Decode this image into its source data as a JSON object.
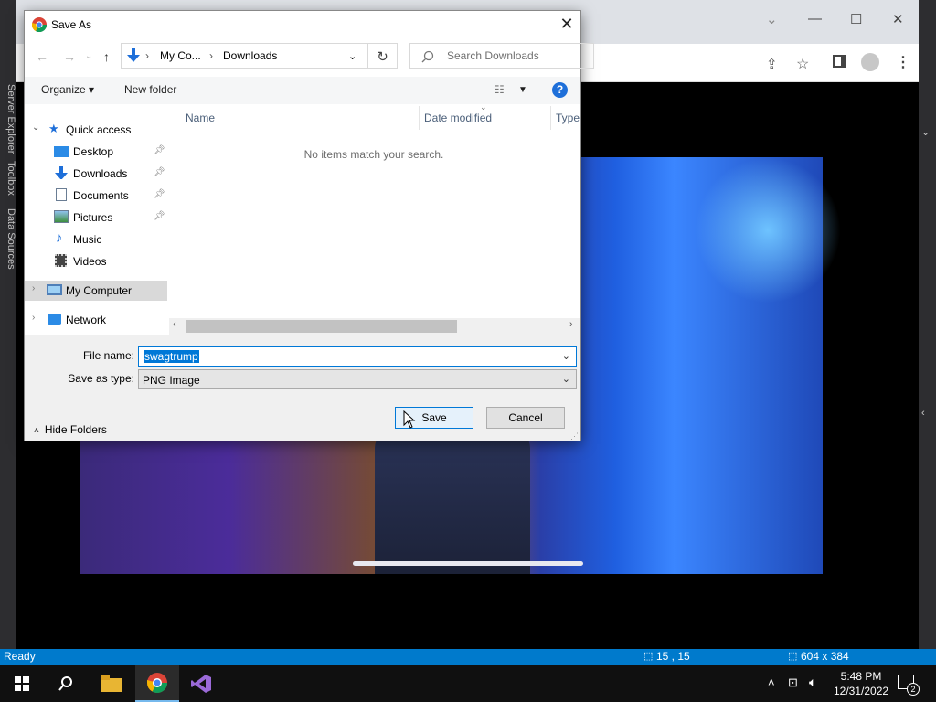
{
  "vs": {
    "left_tabs": [
      "Server Explorer",
      "Toolbox",
      "Data Sources"
    ],
    "status_ready": "Ready",
    "status_cursor": "15 , 15",
    "status_size": "604 x 384"
  },
  "browser": {
    "min": "—",
    "max": "☐",
    "close": "✕",
    "dropdown": "⌄"
  },
  "dialog": {
    "title": "Save As",
    "close": "✕",
    "breadcrumb": [
      "My Co...",
      "Downloads"
    ],
    "search_placeholder": "Search Downloads",
    "organize": "Organize ▾",
    "new_folder": "New folder",
    "help": "?",
    "nav": {
      "quick_access": "Quick access",
      "items": [
        "Desktop",
        "Downloads",
        "Documents",
        "Pictures",
        "Music",
        "Videos"
      ],
      "my_computer": "My Computer",
      "network": "Network"
    },
    "columns": [
      "Name",
      "Date modified",
      "Type"
    ],
    "empty_message": "No items match your search.",
    "file_name_label": "File name:",
    "file_name_value": "swagtrump",
    "save_type_label": "Save as type:",
    "save_type_value": "PNG Image",
    "hide_folders": "Hide Folders",
    "save": "Save",
    "cancel": "Cancel"
  },
  "taskbar": {
    "time": "5:48 PM",
    "date": "12/31/2022",
    "notifications": "2"
  },
  "colors": {
    "accent": "#0078d7",
    "status_bar": "#007acc"
  }
}
